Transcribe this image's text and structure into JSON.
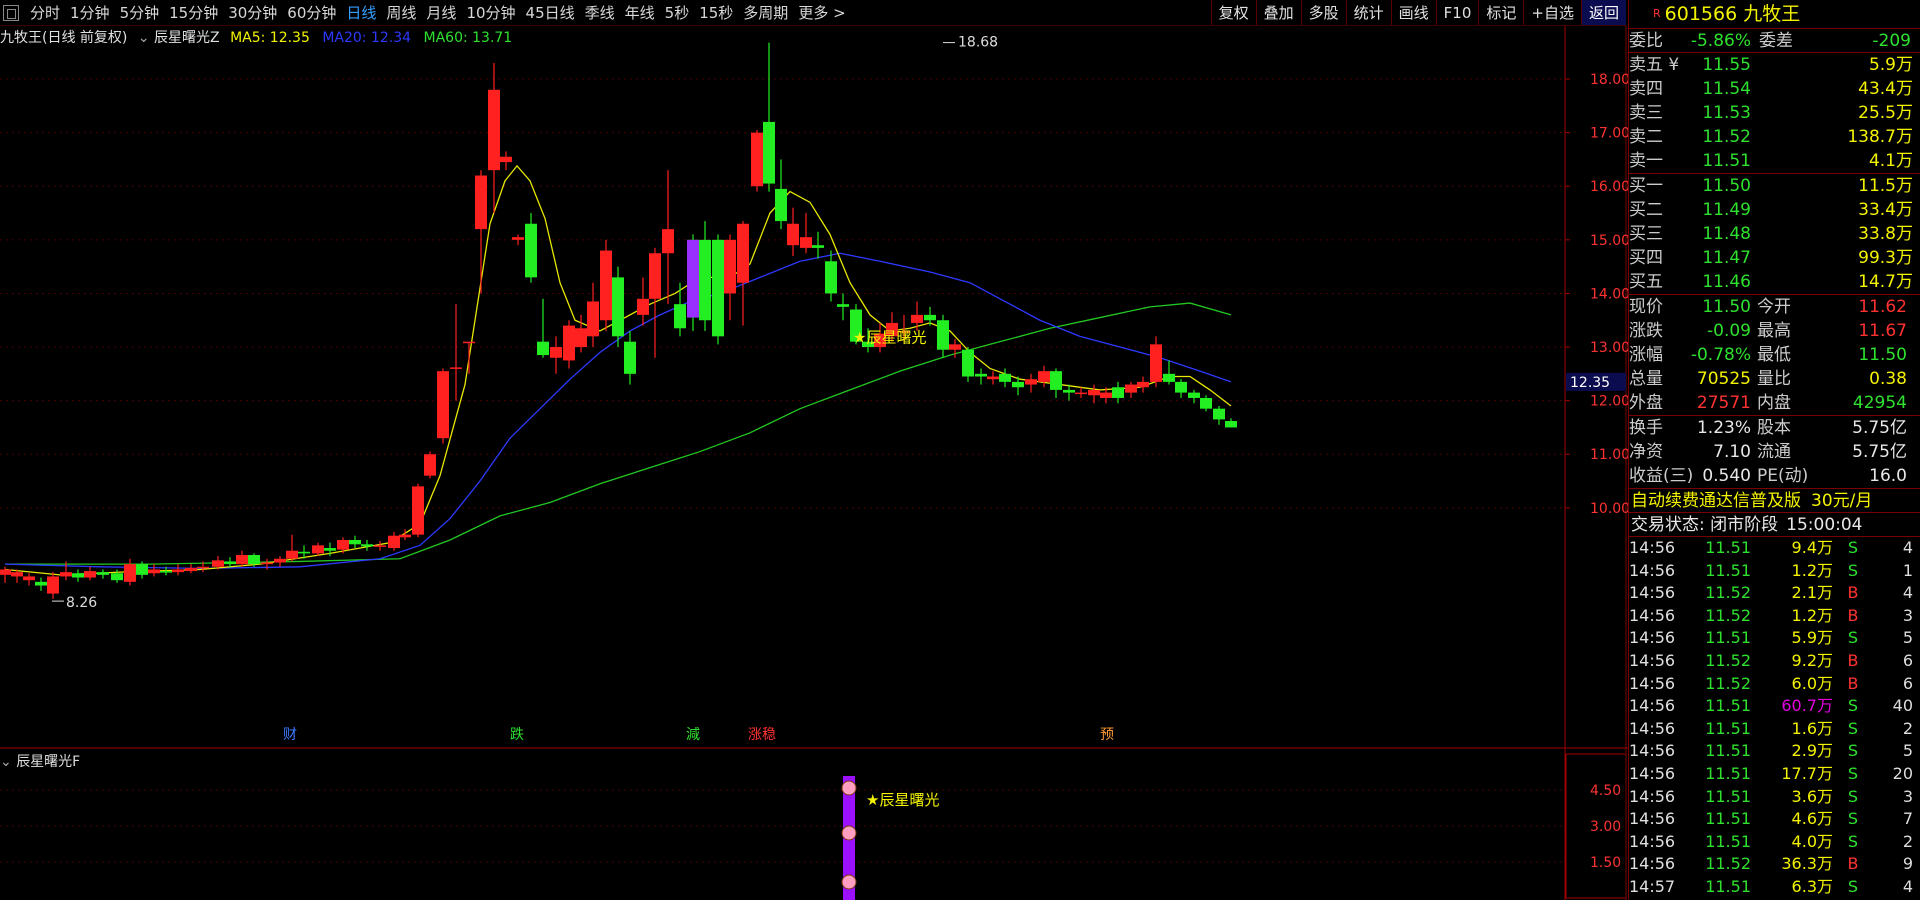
{
  "toolbar": {
    "tabs": [
      "分时",
      "1分钟",
      "5分钟",
      "15分钟",
      "30分钟",
      "60分钟",
      "日线",
      "周线",
      "月线",
      "10分钟",
      "45日线",
      "季线",
      "年线",
      "5秒",
      "15秒",
      "多周期",
      "更多 >"
    ],
    "active_tab": "日线",
    "right_buttons": [
      "复权",
      "叠加",
      "多股",
      "统计",
      "画线",
      "F10",
      "标记",
      "+自选",
      "返回"
    ]
  },
  "chart_header": {
    "name": "九牧王(日线 前复权)",
    "indicator": "辰星曙光Z",
    "ma5": "MA5: 12.35",
    "ma20": "MA20: 12.34",
    "ma60": "MA60: 13.71"
  },
  "chart_data": {
    "type": "candlestick",
    "y_ticks": [
      "18.00",
      "17.00",
      "16.00",
      "15.00",
      "14.00",
      "13.00",
      "12.00",
      "11.00",
      "10.00"
    ],
    "price_tag": "12.35",
    "high_label": "18.68",
    "low_label": "8.26",
    "signal_label": "★辰星曙光",
    "markers": [
      {
        "text": "财",
        "x": 290,
        "color": "#3a7bff"
      },
      {
        "text": "跌",
        "x": 517,
        "color": "#2ee12e"
      },
      {
        "text": "減",
        "x": 693,
        "color": "#2ee12e"
      },
      {
        "text": "涨稳",
        "x": 762,
        "color": "#ff3232"
      },
      {
        "text": "预",
        "x": 1107,
        "color": "#ff9a32"
      }
    ],
    "sub_y_ticks": [
      "4.50",
      "3.00",
      "1.50"
    ],
    "candles": [
      [
        5,
        8.75,
        8.85,
        8.6,
        8.9
      ],
      [
        17,
        8.72,
        8.8,
        8.6,
        8.85
      ],
      [
        29,
        8.65,
        8.72,
        8.55,
        8.78
      ],
      [
        41,
        8.62,
        8.55,
        8.45,
        8.7
      ],
      [
        53,
        8.4,
        8.72,
        8.3,
        8.8
      ],
      [
        66,
        8.72,
        8.8,
        8.65,
        9.0
      ],
      [
        78,
        8.78,
        8.7,
        8.62,
        8.85
      ],
      [
        90,
        8.7,
        8.82,
        8.65,
        8.9
      ],
      [
        103,
        8.8,
        8.75,
        8.68,
        8.85
      ],
      [
        117,
        8.78,
        8.65,
        8.6,
        8.85
      ],
      [
        130,
        8.62,
        8.95,
        8.55,
        9.05
      ],
      [
        142,
        8.95,
        8.75,
        8.68,
        9.0
      ],
      [
        154,
        8.78,
        8.85,
        8.72,
        8.95
      ],
      [
        166,
        8.82,
        8.8,
        8.74,
        8.9
      ],
      [
        178,
        8.8,
        8.85,
        8.74,
        8.95
      ],
      [
        191,
        8.82,
        8.88,
        8.78,
        8.95
      ],
      [
        203,
        8.88,
        8.9,
        8.8,
        9.0
      ],
      [
        218,
        8.9,
        9.02,
        8.85,
        9.1
      ],
      [
        230,
        9.0,
        8.95,
        8.88,
        9.08
      ],
      [
        242,
        8.95,
        9.12,
        8.9,
        9.2
      ],
      [
        254,
        9.12,
        8.95,
        8.9,
        9.15
      ],
      [
        267,
        8.95,
        8.98,
        8.85,
        9.05
      ],
      [
        280,
        8.98,
        9.05,
        8.9,
        9.1
      ],
      [
        292,
        9.05,
        9.2,
        9.0,
        9.5
      ],
      [
        304,
        9.18,
        9.15,
        9.05,
        9.3
      ],
      [
        318,
        9.15,
        9.3,
        9.1,
        9.35
      ],
      [
        330,
        9.25,
        9.2,
        9.1,
        9.35
      ],
      [
        343,
        9.22,
        9.4,
        9.15,
        9.45
      ],
      [
        355,
        9.4,
        9.32,
        9.25,
        9.48
      ],
      [
        367,
        9.32,
        9.28,
        9.2,
        9.4
      ],
      [
        380,
        9.28,
        9.3,
        9.2,
        9.38
      ],
      [
        394,
        9.25,
        9.48,
        9.2,
        9.55
      ],
      [
        405,
        9.45,
        9.5,
        9.4,
        9.6
      ],
      [
        418,
        9.5,
        10.4,
        9.45,
        10.45
      ],
      [
        430,
        10.6,
        11.0,
        10.55,
        11.05
      ],
      [
        443,
        11.3,
        12.55,
        11.2,
        12.6
      ],
      [
        456,
        12.6,
        12.62,
        12.0,
        13.8
      ],
      [
        469,
        13.1,
        13.1,
        12.5,
        13.1
      ],
      [
        481,
        15.2,
        16.2,
        14.0,
        16.3
      ],
      [
        494,
        16.3,
        17.8,
        15.5,
        18.3
      ],
      [
        506,
        16.45,
        16.55,
        16.3,
        16.65
      ],
      [
        518,
        15.0,
        15.05,
        14.9,
        15.1
      ],
      [
        531,
        15.3,
        14.3,
        14.2,
        15.5
      ],
      [
        543,
        13.1,
        12.85,
        12.8,
        13.9
      ],
      [
        556,
        12.8,
        13.0,
        12.5,
        13.2
      ],
      [
        569,
        12.75,
        13.4,
        12.6,
        13.5
      ],
      [
        581,
        13.0,
        13.35,
        12.9,
        13.6
      ],
      [
        593,
        13.2,
        13.85,
        13.0,
        14.2
      ],
      [
        606,
        13.5,
        14.8,
        13.3,
        15.0
      ],
      [
        618,
        14.3,
        13.2,
        13.0,
        14.5
      ],
      [
        630,
        13.1,
        12.5,
        12.3,
        13.3
      ],
      [
        643,
        13.6,
        13.9,
        13.4,
        14.3
      ],
      [
        655,
        13.9,
        14.75,
        12.8,
        14.85
      ],
      [
        668,
        14.75,
        15.2,
        13.8,
        16.3
      ],
      [
        680,
        13.8,
        13.35,
        13.2,
        14.2
      ],
      [
        693,
        15.0,
        13.55,
        13.3,
        15.1
      ],
      [
        705,
        15.0,
        13.5,
        13.3,
        15.35
      ],
      [
        718,
        15.0,
        13.2,
        13.05,
        15.1
      ],
      [
        730,
        14.0,
        15.0,
        13.5,
        15.1
      ],
      [
        743,
        14.2,
        15.3,
        13.4,
        15.35
      ],
      [
        757,
        16.0,
        17.0,
        15.9,
        17.05
      ],
      [
        769,
        17.2,
        16.05,
        15.9,
        18.68
      ],
      [
        781,
        15.95,
        15.35,
        15.2,
        16.5
      ],
      [
        793,
        14.9,
        15.3,
        14.7,
        15.6
      ],
      [
        806,
        14.85,
        15.05,
        14.75,
        15.5
      ],
      [
        818,
        14.9,
        14.85,
        14.65,
        15.15
      ],
      [
        831,
        14.6,
        14.0,
        13.85,
        14.8
      ],
      [
        843,
        13.8,
        13.75,
        13.5,
        14.0
      ],
      [
        856,
        13.7,
        13.1,
        13.05,
        13.8
      ],
      [
        868,
        13.1,
        13.0,
        12.9,
        13.35
      ],
      [
        880,
        13.0,
        13.25,
        12.9,
        13.45
      ],
      [
        892,
        13.2,
        13.45,
        13.1,
        13.65
      ],
      [
        904,
        13.3,
        13.3,
        13.1,
        13.6
      ],
      [
        917,
        13.45,
        13.6,
        13.3,
        13.85
      ],
      [
        930,
        13.6,
        13.5,
        13.4,
        13.75
      ],
      [
        943,
        13.5,
        12.95,
        12.8,
        13.6
      ],
      [
        955,
        12.95,
        13.05,
        12.8,
        13.15
      ],
      [
        968,
        12.95,
        12.45,
        12.35,
        13.0
      ],
      [
        981,
        12.5,
        12.45,
        12.3,
        12.6
      ],
      [
        993,
        12.4,
        12.45,
        12.3,
        12.55
      ],
      [
        1005,
        12.5,
        12.35,
        12.25,
        12.6
      ],
      [
        1018,
        12.35,
        12.25,
        12.1,
        12.45
      ],
      [
        1031,
        12.3,
        12.4,
        12.15,
        12.5
      ],
      [
        1044,
        12.35,
        12.55,
        12.25,
        12.65
      ],
      [
        1056,
        12.55,
        12.2,
        12.05,
        12.6
      ],
      [
        1069,
        12.2,
        12.15,
        12.0,
        12.3
      ],
      [
        1081,
        12.15,
        12.15,
        12.05,
        12.25
      ],
      [
        1094,
        12.1,
        12.2,
        11.95,
        12.3
      ],
      [
        1106,
        12.05,
        12.15,
        11.95,
        12.25
      ],
      [
        1118,
        12.25,
        12.05,
        11.95,
        12.35
      ],
      [
        1131,
        12.15,
        12.3,
        12.05,
        12.35
      ],
      [
        1143,
        12.25,
        12.35,
        12.15,
        12.45
      ],
      [
        1156,
        12.35,
        13.05,
        12.25,
        13.2
      ],
      [
        1169,
        12.5,
        12.35,
        12.3,
        12.75
      ],
      [
        1181,
        12.35,
        12.15,
        12.05,
        12.4
      ],
      [
        1194,
        12.15,
        12.05,
        11.95,
        12.2
      ],
      [
        1206,
        12.05,
        11.85,
        11.8,
        12.1
      ],
      [
        1219,
        11.85,
        11.65,
        11.55,
        11.9
      ],
      [
        1231,
        11.62,
        11.5,
        11.5,
        11.67
      ]
    ],
    "ma5": [
      [
        5,
        8.85
      ],
      [
        60,
        8.75
      ],
      [
        120,
        8.8
      ],
      [
        200,
        8.85
      ],
      [
        260,
        8.95
      ],
      [
        330,
        9.15
      ],
      [
        390,
        9.35
      ],
      [
        420,
        9.7
      ],
      [
        440,
        10.6
      ],
      [
        465,
        12.3
      ],
      [
        490,
        15.3
      ],
      [
        505,
        16.1
      ],
      [
        517,
        16.38
      ],
      [
        530,
        16.1
      ],
      [
        545,
        15.4
      ],
      [
        560,
        14.2
      ],
      [
        575,
        13.5
      ],
      [
        600,
        13.3
      ],
      [
        625,
        13.55
      ],
      [
        650,
        13.8
      ],
      [
        675,
        14.0
      ],
      [
        700,
        14.3
      ],
      [
        730,
        14.3
      ],
      [
        750,
        14.55
      ],
      [
        770,
        15.5
      ],
      [
        790,
        15.9
      ],
      [
        810,
        15.7
      ],
      [
        830,
        15.1
      ],
      [
        850,
        14.2
      ],
      [
        870,
        13.6
      ],
      [
        890,
        13.3
      ],
      [
        910,
        13.35
      ],
      [
        930,
        13.45
      ],
      [
        950,
        13.3
      ],
      [
        970,
        12.9
      ],
      [
        990,
        12.6
      ],
      [
        1020,
        12.4
      ],
      [
        1060,
        12.3
      ],
      [
        1100,
        12.2
      ],
      [
        1140,
        12.25
      ],
      [
        1170,
        12.45
      ],
      [
        1190,
        12.45
      ],
      [
        1210,
        12.2
      ],
      [
        1231,
        11.9
      ]
    ],
    "ma20": [
      [
        5,
        8.95
      ],
      [
        100,
        8.9
      ],
      [
        200,
        8.87
      ],
      [
        300,
        8.9
      ],
      [
        380,
        9.05
      ],
      [
        420,
        9.3
      ],
      [
        450,
        9.8
      ],
      [
        480,
        10.5
      ],
      [
        510,
        11.3
      ],
      [
        540,
        11.85
      ],
      [
        570,
        12.4
      ],
      [
        600,
        12.9
      ],
      [
        630,
        13.3
      ],
      [
        660,
        13.6
      ],
      [
        690,
        13.85
      ],
      [
        720,
        14.0
      ],
      [
        760,
        14.3
      ],
      [
        800,
        14.6
      ],
      [
        840,
        14.75
      ],
      [
        880,
        14.6
      ],
      [
        930,
        14.4
      ],
      [
        970,
        14.2
      ],
      [
        1000,
        13.9
      ],
      [
        1040,
        13.5
      ],
      [
        1080,
        13.2
      ],
      [
        1120,
        13.0
      ],
      [
        1160,
        12.8
      ],
      [
        1200,
        12.55
      ],
      [
        1231,
        12.35
      ]
    ],
    "ma60": [
      [
        5,
        8.95
      ],
      [
        150,
        8.95
      ],
      [
        300,
        9.0
      ],
      [
        400,
        9.05
      ],
      [
        450,
        9.4
      ],
      [
        500,
        9.85
      ],
      [
        550,
        10.1
      ],
      [
        600,
        10.45
      ],
      [
        650,
        10.75
      ],
      [
        700,
        11.05
      ],
      [
        750,
        11.4
      ],
      [
        800,
        11.85
      ],
      [
        850,
        12.2
      ],
      [
        900,
        12.55
      ],
      [
        950,
        12.85
      ],
      [
        1000,
        13.1
      ],
      [
        1050,
        13.35
      ],
      [
        1100,
        13.55
      ],
      [
        1150,
        13.75
      ],
      [
        1190,
        13.82
      ],
      [
        1231,
        13.6
      ]
    ]
  },
  "subchart": {
    "title": "辰星曙光F",
    "signal_label": "★辰星曙光"
  },
  "quote": {
    "code_prefix": "R",
    "code": "601566",
    "name": "九牧王",
    "weibi_label": "委比",
    "weibi": "-5.86%",
    "weicha_label": "委差",
    "weicha": "-209",
    "asks": [
      {
        "label": "卖五 ¥",
        "price": "11.55",
        "vol": "5.9万"
      },
      {
        "label": "卖四",
        "price": "11.54",
        "vol": "43.4万"
      },
      {
        "label": "卖三",
        "price": "11.53",
        "vol": "25.5万"
      },
      {
        "label": "卖二",
        "price": "11.52",
        "vol": "138.7万"
      },
      {
        "label": "卖一",
        "price": "11.51",
        "vol": "4.1万"
      }
    ],
    "bids": [
      {
        "label": "买一",
        "price": "11.50",
        "vol": "11.5万"
      },
      {
        "label": "买二",
        "price": "11.49",
        "vol": "33.4万"
      },
      {
        "label": "买三",
        "price": "11.48",
        "vol": "33.8万"
      },
      {
        "label": "买四",
        "price": "11.47",
        "vol": "99.3万"
      },
      {
        "label": "买五",
        "price": "11.46",
        "vol": "14.7万"
      }
    ],
    "stats": [
      {
        "l1": "现价",
        "v1": "11.50",
        "c1": "green",
        "l2": "今开",
        "v2": "11.62",
        "c2": "red"
      },
      {
        "l1": "涨跌",
        "v1": "-0.09",
        "c1": "green",
        "l2": "最高",
        "v2": "11.67",
        "c2": "red"
      },
      {
        "l1": "涨幅",
        "v1": "-0.78%",
        "c1": "green",
        "l2": "最低",
        "v2": "11.50",
        "c2": "green"
      },
      {
        "l1": "总量",
        "v1": "70525",
        "c1": "yel",
        "l2": "量比",
        "v2": "0.38",
        "c2": "yel"
      },
      {
        "l1": "外盘",
        "v1": "27571",
        "c1": "red",
        "l2": "内盘",
        "v2": "42954",
        "c2": "green"
      }
    ],
    "stats2": [
      {
        "l1": "换手",
        "v1": "1.23%",
        "l2": "股本",
        "v2": "5.75亿"
      },
      {
        "l1": "净资",
        "v1": "7.10",
        "l2": "流通",
        "v2": "5.75亿"
      },
      {
        "l1": "收益(三)",
        "v1": "0.540",
        "l2": "PE(动)",
        "v2": "16.0"
      }
    ],
    "ad_text": "自动续费通达信普及版",
    "ad_price": "30元/月",
    "status_label": "交易状态: 闭市阶段",
    "status_time": "15:00:04"
  },
  "ticks": [
    {
      "t": "14:56",
      "p": "11.51",
      "v": "9.4万",
      "bs": "S",
      "n": "4"
    },
    {
      "t": "14:56",
      "p": "11.51",
      "v": "1.2万",
      "bs": "S",
      "n": "1"
    },
    {
      "t": "14:56",
      "p": "11.52",
      "v": "2.1万",
      "bs": "B",
      "n": "4"
    },
    {
      "t": "14:56",
      "p": "11.52",
      "v": "1.2万",
      "bs": "B",
      "n": "3"
    },
    {
      "t": "14:56",
      "p": "11.51",
      "v": "5.9万",
      "bs": "S",
      "n": "5"
    },
    {
      "t": "14:56",
      "p": "11.52",
      "v": "9.2万",
      "bs": "B",
      "n": "6"
    },
    {
      "t": "14:56",
      "p": "11.52",
      "v": "6.0万",
      "bs": "B",
      "n": "6"
    },
    {
      "t": "14:56",
      "p": "11.51",
      "v": "60.7万",
      "bs": "S",
      "n": "40",
      "hl": true
    },
    {
      "t": "14:56",
      "p": "11.51",
      "v": "1.6万",
      "bs": "S",
      "n": "2"
    },
    {
      "t": "14:56",
      "p": "11.51",
      "v": "2.9万",
      "bs": "S",
      "n": "5"
    },
    {
      "t": "14:56",
      "p": "11.51",
      "v": "17.7万",
      "bs": "S",
      "n": "20"
    },
    {
      "t": "14:56",
      "p": "11.51",
      "v": "3.6万",
      "bs": "S",
      "n": "3"
    },
    {
      "t": "14:56",
      "p": "11.51",
      "v": "4.6万",
      "bs": "S",
      "n": "7"
    },
    {
      "t": "14:56",
      "p": "11.51",
      "v": "4.0万",
      "bs": "S",
      "n": "2"
    },
    {
      "t": "14:56",
      "p": "11.52",
      "v": "36.3万",
      "bs": "B",
      "n": "9"
    },
    {
      "t": "14:57",
      "p": "11.51",
      "v": "6.3万",
      "bs": "S",
      "n": "4"
    }
  ]
}
